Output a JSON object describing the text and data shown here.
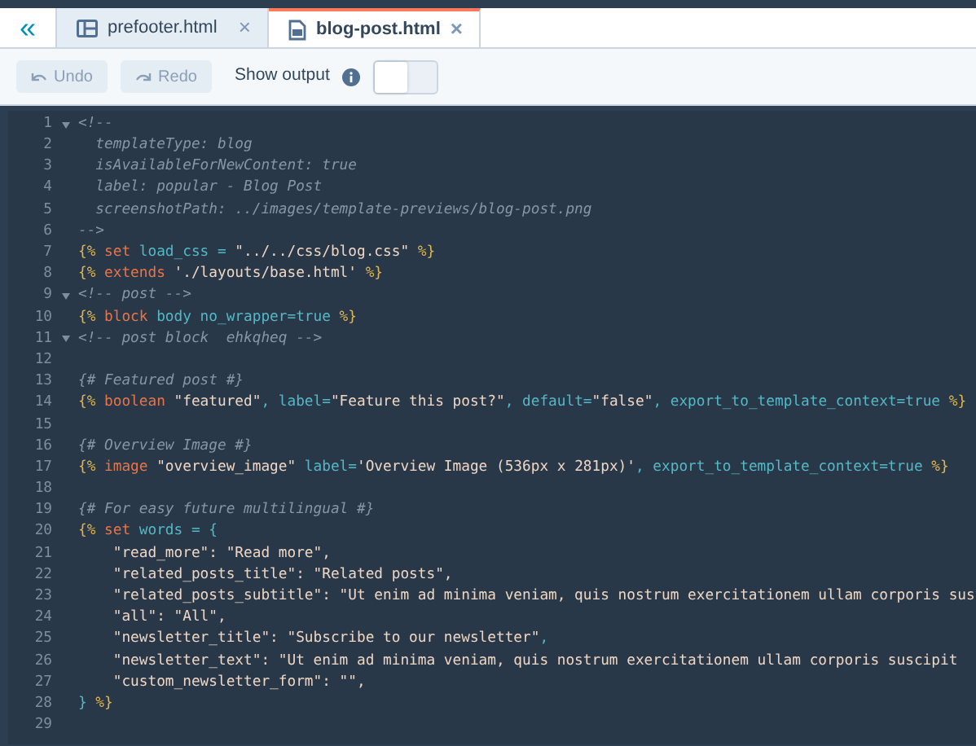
{
  "tabs": [
    {
      "label": "prefooter.html",
      "selected": false,
      "close": "×"
    },
    {
      "label": "blog-post.html",
      "selected": true,
      "close": "×"
    }
  ],
  "collapse": "«",
  "toolbar": {
    "undo": {
      "label": "Undo",
      "disabled": true
    },
    "redo": {
      "label": "Redo",
      "disabled": true
    },
    "show_output": {
      "label": "Show output",
      "on": false
    }
  },
  "code_lines": [
    {
      "number": "1",
      "foldable": true,
      "tokens": [
        {
          "kind": "comment",
          "text": "<!--"
        }
      ]
    },
    {
      "number": "2",
      "foldable": false,
      "tokens": [
        {
          "kind": "comment",
          "text": "  templateType: blog"
        }
      ]
    },
    {
      "number": "3",
      "foldable": false,
      "tokens": [
        {
          "kind": "comment",
          "text": "  isAvailableForNewContent: true"
        }
      ]
    },
    {
      "number": "4",
      "foldable": false,
      "tokens": [
        {
          "kind": "comment",
          "text": "  label: popular - Blog Post"
        }
      ]
    },
    {
      "number": "5",
      "foldable": false,
      "tokens": [
        {
          "kind": "comment",
          "text": "  screenshotPath: ../images/template-previews/blog-post.png"
        }
      ]
    },
    {
      "number": "6",
      "foldable": false,
      "tokens": [
        {
          "kind": "comment",
          "text": "-->"
        }
      ]
    },
    {
      "number": "7",
      "foldable": false,
      "tokens": [
        {
          "kind": "tag",
          "text": "{%"
        },
        {
          "kind": "keyword",
          "text": " set"
        },
        {
          "kind": "name",
          "text": " load_css ="
        },
        {
          "kind": "string",
          "text": " \"../../css/blog.css\""
        },
        {
          "kind": "tag",
          "text": " %}"
        }
      ]
    },
    {
      "number": "8",
      "foldable": false,
      "tokens": [
        {
          "kind": "tag",
          "text": "{%"
        },
        {
          "kind": "keyword",
          "text": " extends"
        },
        {
          "kind": "string",
          "text": " './layouts/base.html'"
        },
        {
          "kind": "tag",
          "text": " %}"
        }
      ]
    },
    {
      "number": "9",
      "foldable": true,
      "tokens": [
        {
          "kind": "comment",
          "text": "<!-- post -->"
        }
      ]
    },
    {
      "number": "10",
      "foldable": false,
      "tokens": [
        {
          "kind": "tag",
          "text": "{%"
        },
        {
          "kind": "keyword",
          "text": " block"
        },
        {
          "kind": "name",
          "text": " body no_wrapper=true"
        },
        {
          "kind": "tag",
          "text": " %}"
        }
      ]
    },
    {
      "number": "11",
      "foldable": true,
      "tokens": [
        {
          "kind": "comment",
          "text": "<!-- post block  ehkqheq -->"
        }
      ]
    },
    {
      "number": "12",
      "foldable": false
    },
    {
      "number": "13",
      "foldable": false,
      "tokens": [
        {
          "kind": "comment",
          "text": "{# Featured post #}"
        }
      ]
    },
    {
      "number": "14",
      "foldable": false,
      "tokens": [
        {
          "kind": "tag",
          "text": "{%"
        },
        {
          "kind": "keyword",
          "text": " boolean"
        },
        {
          "kind": "string",
          "text": " \"featured\""
        },
        {
          "kind": "name",
          "text": ", label="
        },
        {
          "kind": "string",
          "text": "\"Feature this post?\""
        },
        {
          "kind": "name",
          "text": ", default="
        },
        {
          "kind": "string",
          "text": "\"false\""
        },
        {
          "kind": "name",
          "text": ", export_to_template_context=true"
        },
        {
          "kind": "tag",
          "text": " %}"
        }
      ]
    },
    {
      "number": "15",
      "foldable": false
    },
    {
      "number": "16",
      "foldable": false,
      "tokens": [
        {
          "kind": "comment",
          "text": "{# Overview Image #}"
        }
      ]
    },
    {
      "number": "17",
      "foldable": false,
      "tokens": [
        {
          "kind": "tag",
          "text": "{%"
        },
        {
          "kind": "keyword",
          "text": " image"
        },
        {
          "kind": "string",
          "text": " \"overview_image\""
        },
        {
          "kind": "name",
          "text": " label="
        },
        {
          "kind": "string",
          "text": "'Overview Image (536px x 281px)'"
        },
        {
          "kind": "name",
          "text": ", export_to_template_context=true"
        },
        {
          "kind": "tag",
          "text": " %}"
        }
      ]
    },
    {
      "number": "18",
      "foldable": false
    },
    {
      "number": "19",
      "foldable": false,
      "tokens": [
        {
          "kind": "comment",
          "text": "{# For easy future multilingual #}"
        }
      ]
    },
    {
      "number": "20",
      "foldable": false,
      "tokens": [
        {
          "kind": "tag",
          "text": "{%"
        },
        {
          "kind": "keyword",
          "text": " set"
        },
        {
          "kind": "name",
          "text": " words = {"
        }
      ]
    },
    {
      "number": "21",
      "foldable": false,
      "tokens": [
        {
          "kind": "string",
          "text": "    \"read_more\": \"Read more\","
        }
      ]
    },
    {
      "number": "22",
      "foldable": false,
      "tokens": [
        {
          "kind": "string",
          "text": "    \"related_posts_title\": \"Related posts\","
        }
      ]
    },
    {
      "number": "23",
      "foldable": false,
      "tokens": [
        {
          "kind": "string",
          "text": "    \"related_posts_subtitle\": \"Ut enim ad minima veniam, quis nostrum exercitationem ullam corporis sus"
        }
      ]
    },
    {
      "number": "24",
      "foldable": false,
      "tokens": [
        {
          "kind": "string",
          "text": "    \"all\": \"All\","
        }
      ]
    },
    {
      "number": "25",
      "foldable": false,
      "tokens": [
        {
          "kind": "string",
          "text": "    \"newsletter_title\": \"Subscribe to our newsletter\""
        },
        {
          "kind": "name",
          "text": ","
        }
      ]
    },
    {
      "number": "26",
      "foldable": false,
      "tokens": [
        {
          "kind": "string",
          "text": "    \"newsletter_text\": \"Ut enim ad minima veniam, quis nostrum exercitationem ullam corporis suscipit"
        }
      ]
    },
    {
      "number": "27",
      "foldable": false,
      "tokens": [
        {
          "kind": "string",
          "text": "    \"custom_newsletter_form\": \"\","
        }
      ]
    },
    {
      "number": "28",
      "foldable": false,
      "tokens": [
        {
          "kind": "name",
          "text": "}"
        },
        {
          "kind": "tag",
          "text": " %}"
        }
      ]
    },
    {
      "number": "29",
      "foldable": false
    }
  ]
}
